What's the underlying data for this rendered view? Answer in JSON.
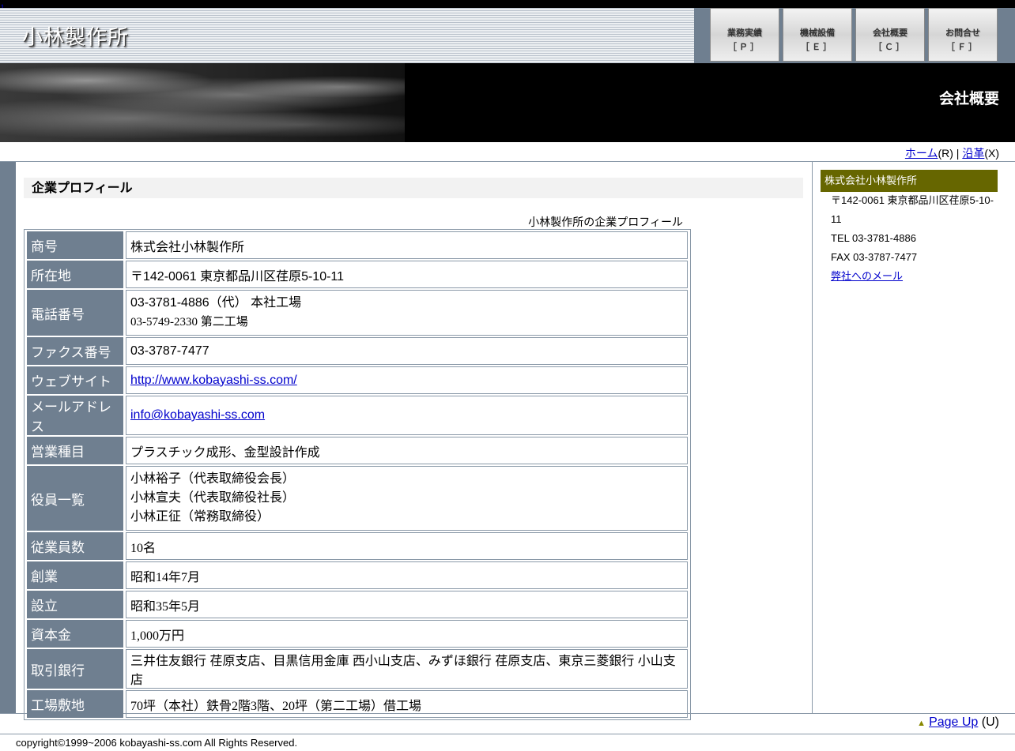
{
  "top": {
    "broken_image_alt": "1"
  },
  "header": {
    "logo": "小林製作所",
    "nav": [
      {
        "label": "業務実績",
        "key": "［Ｐ］"
      },
      {
        "label": "機械設備",
        "key": "［Ｅ］"
      },
      {
        "label": "会社概要",
        "key": "［Ｃ］"
      },
      {
        "label": "お問合せ",
        "key": "［Ｆ］"
      }
    ]
  },
  "banner": {
    "title": "会社概要"
  },
  "breadcrumb": {
    "home": "ホーム",
    "home_key": "(R)",
    "sep": " | ",
    "history": "沿革",
    "history_key": "(X)"
  },
  "main": {
    "section_title": "企業プロフィール",
    "table_caption": "小林製作所の企業プロフィール",
    "profile": {
      "trade_name": {
        "label": "商号",
        "value": "株式会社小林製作所"
      },
      "address": {
        "label": "所在地",
        "value": "〒142-0061 東京都品川区荏原5-10-11"
      },
      "phone": {
        "label": "電話番号",
        "line1": "03-3781-4886（代） 本社工場",
        "line2": "03-5749-2330 第二工場"
      },
      "fax": {
        "label": "ファクス番号",
        "value": "03-3787-7477"
      },
      "website": {
        "label": "ウェブサイト",
        "value": "http://www.kobayashi-ss.com/"
      },
      "email": {
        "label": "メールアドレス",
        "value": "info@kobayashi-ss.com"
      },
      "business": {
        "label": "営業種目",
        "value": "プラスチック成形、金型設計作成"
      },
      "officers": {
        "label": "役員一覧",
        "line1": "小林裕子（代表取締役会長）",
        "line2": "小林宣夫（代表取締役社長）",
        "line3": "小林正征（常務取締役）"
      },
      "employees": {
        "label": "従業員数",
        "value": "10名"
      },
      "founded": {
        "label": "創業",
        "value": "昭和14年7月"
      },
      "established": {
        "label": "設立",
        "value": "昭和35年5月"
      },
      "capital": {
        "label": "資本金",
        "value": "1,000万円"
      },
      "banks": {
        "label": "取引銀行",
        "value": "三井住友銀行 荏原支店、目黒信用金庫 西小山支店、みずほ銀行 荏原支店、東京三菱銀行 小山支店"
      },
      "factory": {
        "label": "工場敷地",
        "value": "70坪（本社）鉄骨2階3階、20坪（第二工場）借工場"
      }
    }
  },
  "sidebar": {
    "company": "株式会社小林製作所",
    "address": "〒142-0061 東京都品川区荏原5-10-11",
    "tel": "TEL 03-3781-4886",
    "fax": "FAX 03-3787-7477",
    "mail_link": "弊社へのメール"
  },
  "footer": {
    "pageup": "Page Up",
    "pageup_key": "(U)",
    "copyright": "copyright©1999~2006 kobayashi-ss.com All Rights Reserved."
  },
  "colors": {
    "slate": "#6f7f90",
    "olive": "#666600",
    "link": "#0000cc"
  }
}
